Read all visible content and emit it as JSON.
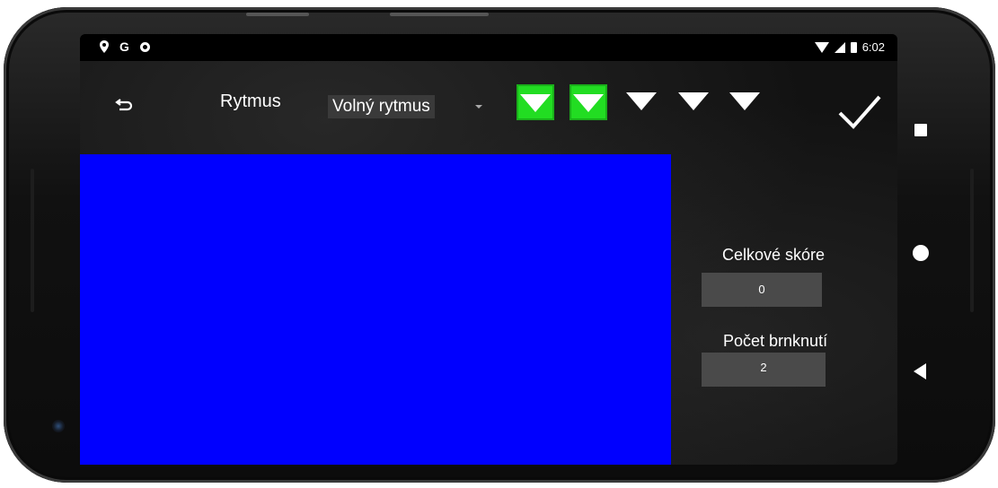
{
  "status_bar": {
    "left_icons": [
      "location-icon",
      "G",
      "circle-icon"
    ],
    "google_letter": "G",
    "time": "6:02"
  },
  "toolbar": {
    "rhythm_label": "Rytmus",
    "rhythm_selected": "Volný rytmus",
    "strum_buttons": [
      {
        "active": true
      },
      {
        "active": true
      },
      {
        "active": false
      },
      {
        "active": false
      },
      {
        "active": false
      }
    ]
  },
  "scores": {
    "total_label": "Celkové skóre",
    "total_value": "0",
    "strums_label": "Počet brnknutí",
    "strums_value": "2"
  },
  "colors": {
    "game_area": "#0000ff",
    "strum_active": "#22dd22"
  }
}
